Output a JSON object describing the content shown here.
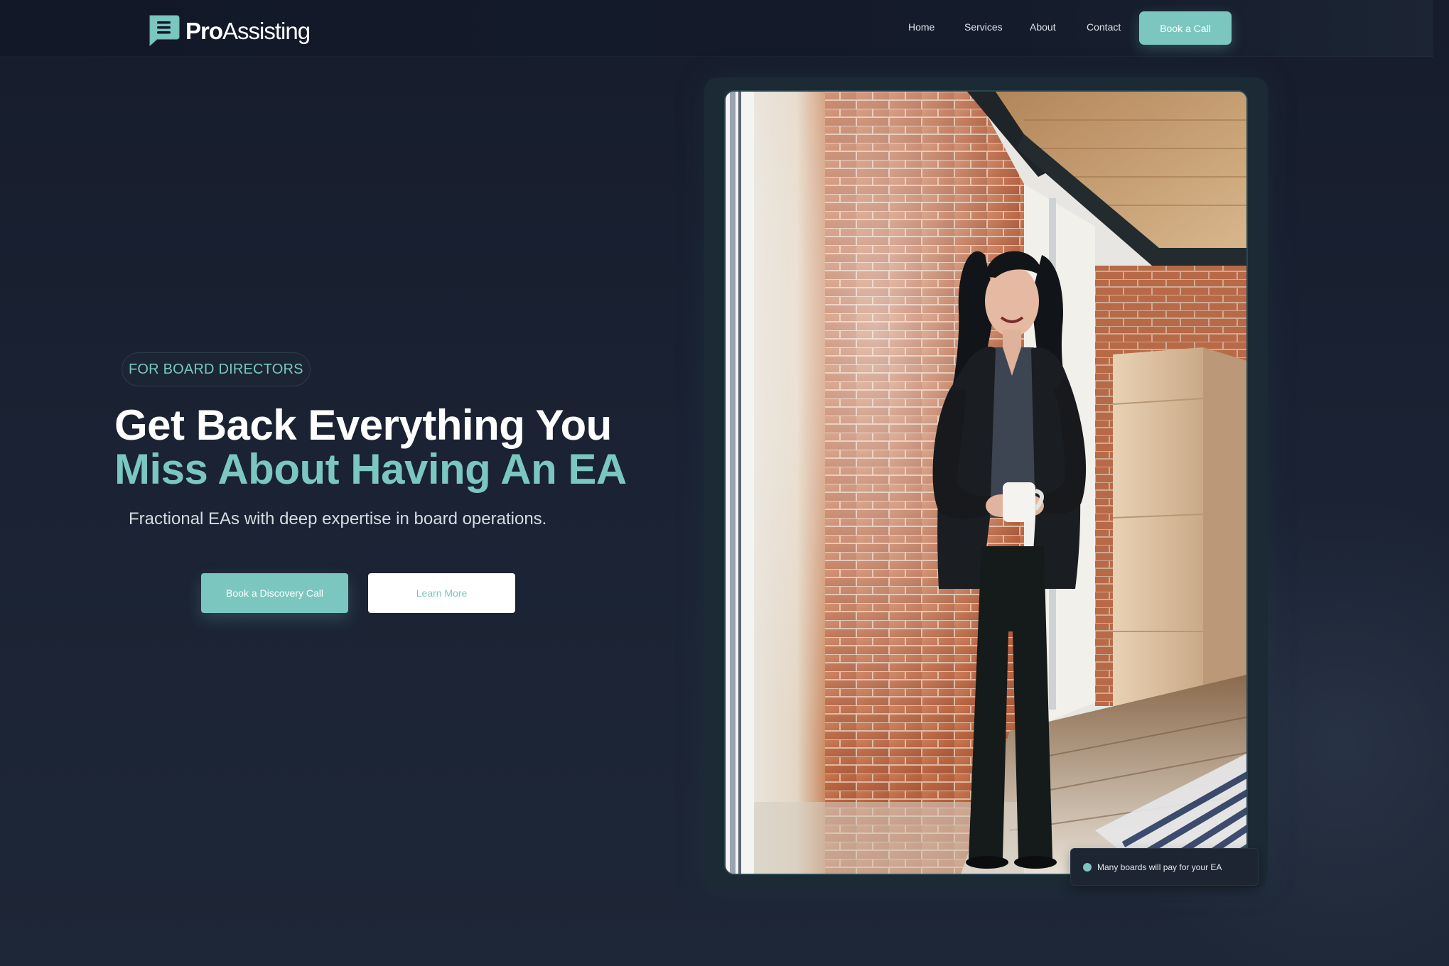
{
  "brand": {
    "name_bold": "Pro",
    "name_regular": "Assisting",
    "logo_icon": "chat-bubble-lines-icon",
    "accent_color": "#7bc7c0"
  },
  "nav": {
    "links": [
      "Home",
      "Services",
      "About",
      "Contact"
    ],
    "cta_label": "Book a Call"
  },
  "hero": {
    "badge": "FOR BOARD DIRECTORS",
    "headline_line1": "Get Back Everything You",
    "headline_line2": "Miss About Having An EA",
    "subtitle": "Fractional EAs with deep expertise in board operations.",
    "primary_button": "Book a Discovery Call",
    "secondary_button": "Learn More"
  },
  "photo": {
    "toast_text": "Many boards will pay for your EA"
  }
}
